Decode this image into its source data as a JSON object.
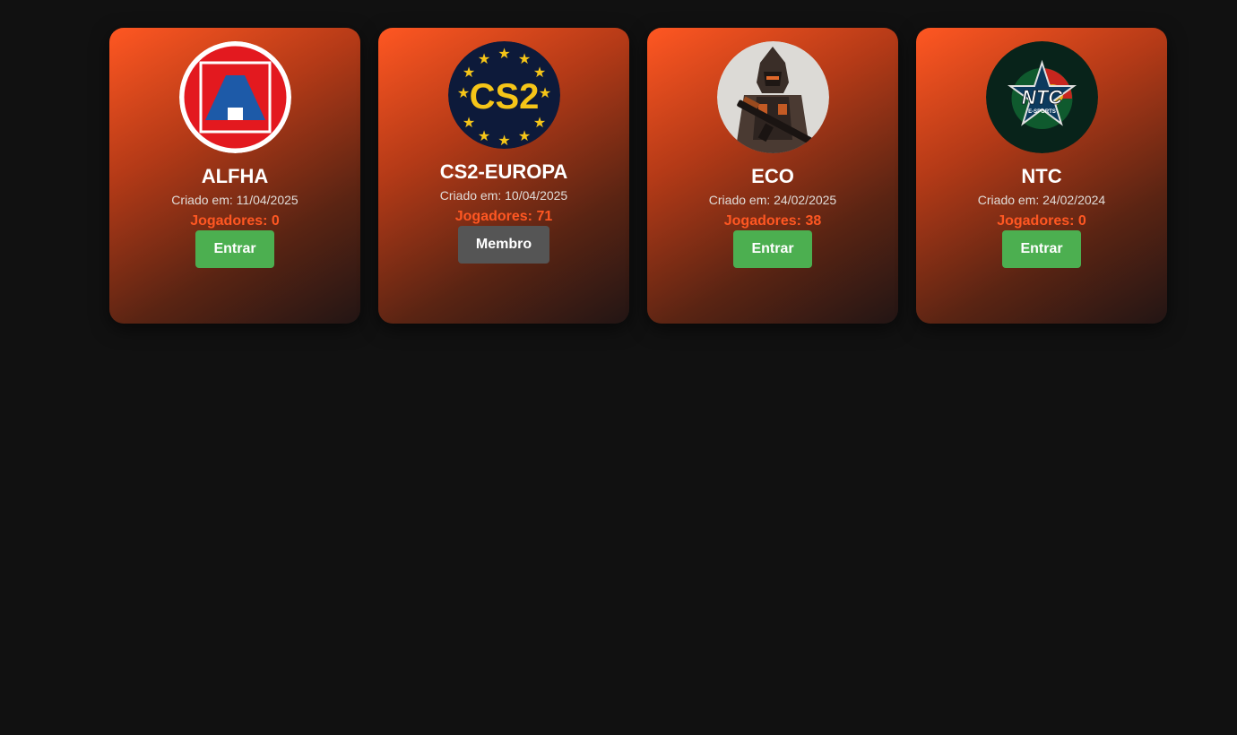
{
  "teams": [
    {
      "name": "ALFHA",
      "created": "Criado em: 11/04/2025",
      "players": "Jogadores: 0",
      "action": "Entrar",
      "logo_text": "A"
    },
    {
      "name": "CS2-EUROPA",
      "created": "Criado em: 10/04/2025",
      "players": "Jogadores: 71",
      "action": "Membro",
      "logo_text": "CS2"
    },
    {
      "name": "ECO",
      "created": "Criado em: 24/02/2025",
      "players": "Jogadores: 38",
      "action": "Entrar",
      "logo_text": ""
    },
    {
      "name": "NTC",
      "created": "Criado em: 24/02/2024",
      "players": "Jogadores: 0",
      "action": "Entrar",
      "logo_text": "NTC",
      "logo_subtext": "E-SPORTS"
    }
  ],
  "colors": {
    "background": "#111111",
    "accent": "#ff5722",
    "enter_button": "#4caf50",
    "member_button": "#555555"
  }
}
